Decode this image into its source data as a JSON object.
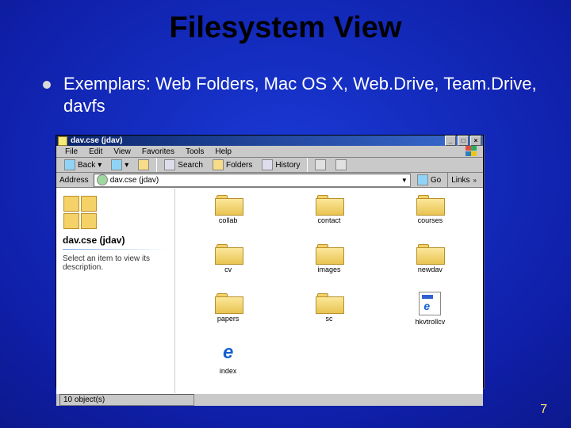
{
  "slide": {
    "title": "Filesystem View",
    "bullet": "Exemplars: Web Folders, Mac OS X, Web.Drive, Team.Drive, davfs",
    "page_number": "7"
  },
  "window": {
    "title": "dav.cse (jdav)",
    "btn_min": "_",
    "btn_max": "□",
    "btn_close": "×",
    "menu": [
      "File",
      "Edit",
      "View",
      "Favorites",
      "Tools",
      "Help"
    ],
    "toolbar": {
      "back": "Back",
      "search": "Search",
      "folders": "Folders",
      "history": "History"
    },
    "address": {
      "label": "Address",
      "value": "dav.cse (jdav)",
      "go": "Go",
      "links": "Links"
    },
    "side": {
      "title": "dav.cse (jdav)",
      "desc": "Select an item to view its description."
    },
    "items": [
      {
        "name": "collab",
        "type": "folder"
      },
      {
        "name": "contact",
        "type": "folder"
      },
      {
        "name": "courses",
        "type": "folder"
      },
      {
        "name": "cv",
        "type": "folder"
      },
      {
        "name": "images",
        "type": "folder"
      },
      {
        "name": "newdav",
        "type": "folder"
      },
      {
        "name": "papers",
        "type": "folder"
      },
      {
        "name": "sc",
        "type": "folder"
      },
      {
        "name": "hkvtrollcv",
        "type": "html"
      },
      {
        "name": "index",
        "type": "ie"
      }
    ],
    "status": "10 object(s)"
  }
}
